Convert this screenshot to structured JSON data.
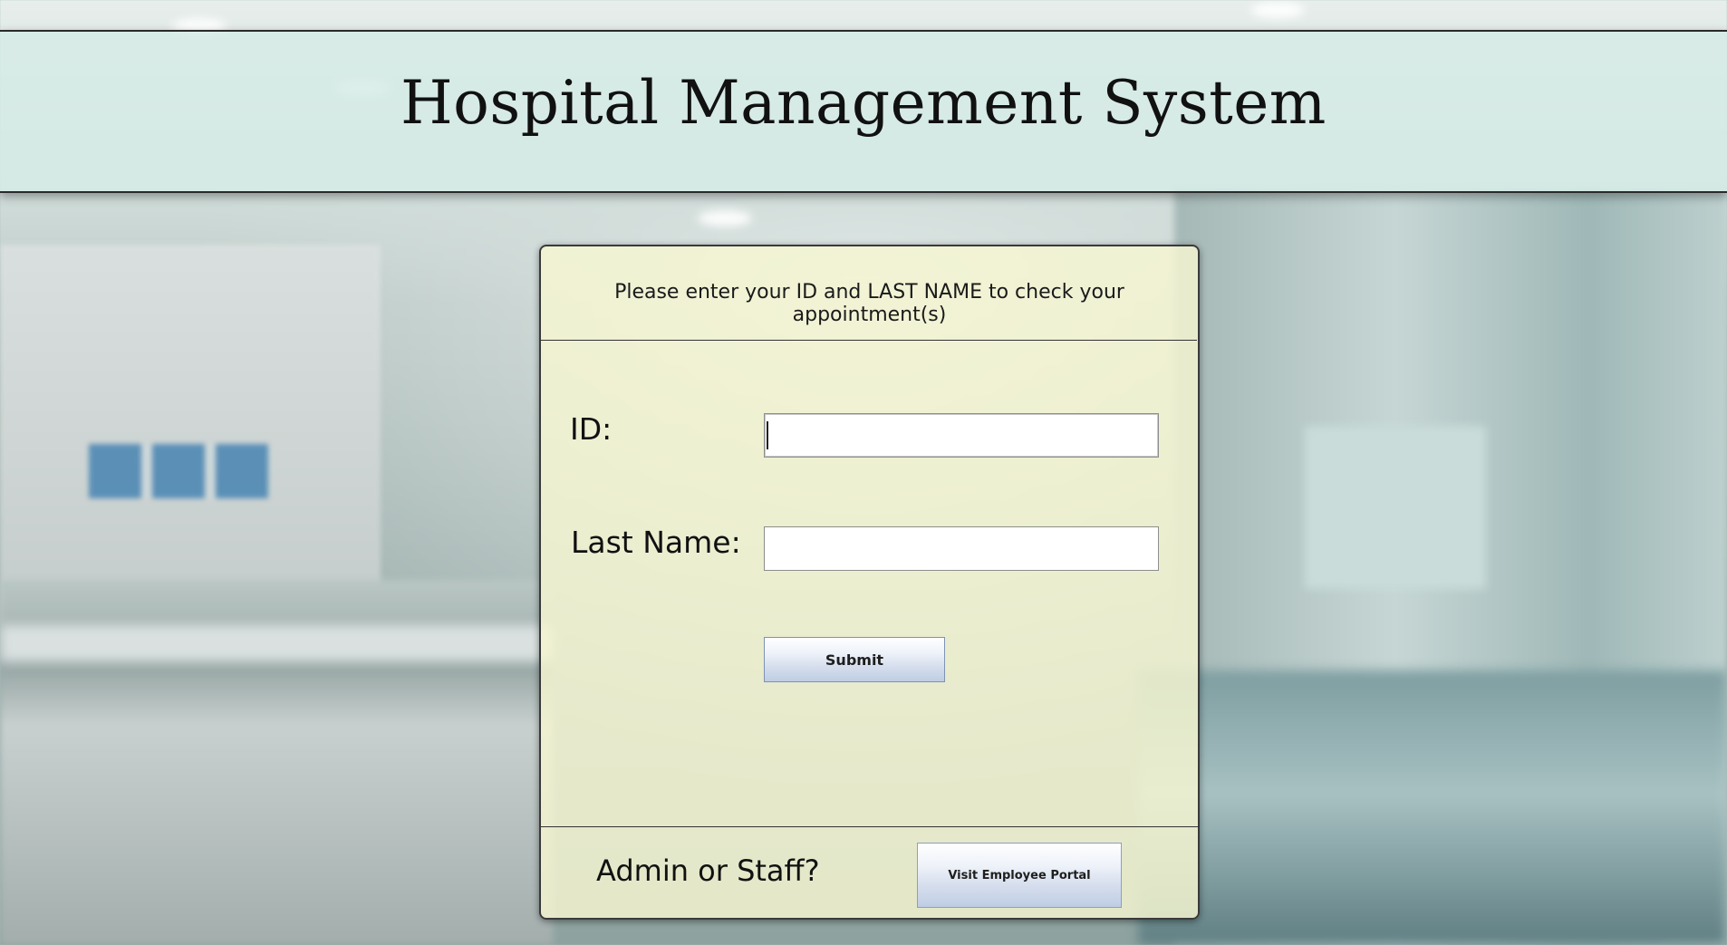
{
  "header": {
    "title": "Hospital Management System"
  },
  "login_panel": {
    "instructions": "Please enter your ID and LAST NAME to check your appointment(s)",
    "id_label": "ID:",
    "id_value": "",
    "last_name_label": "Last Name:",
    "last_name_value": "",
    "submit_label": "Submit"
  },
  "footer": {
    "prompt": "Admin or Staff?",
    "portal_button_label": "Visit Employee Portal"
  },
  "colors": {
    "header_background": "#d6ece6",
    "panel_background": "#f6f6d2",
    "button_gradient_bottom": "#bfcde4"
  }
}
